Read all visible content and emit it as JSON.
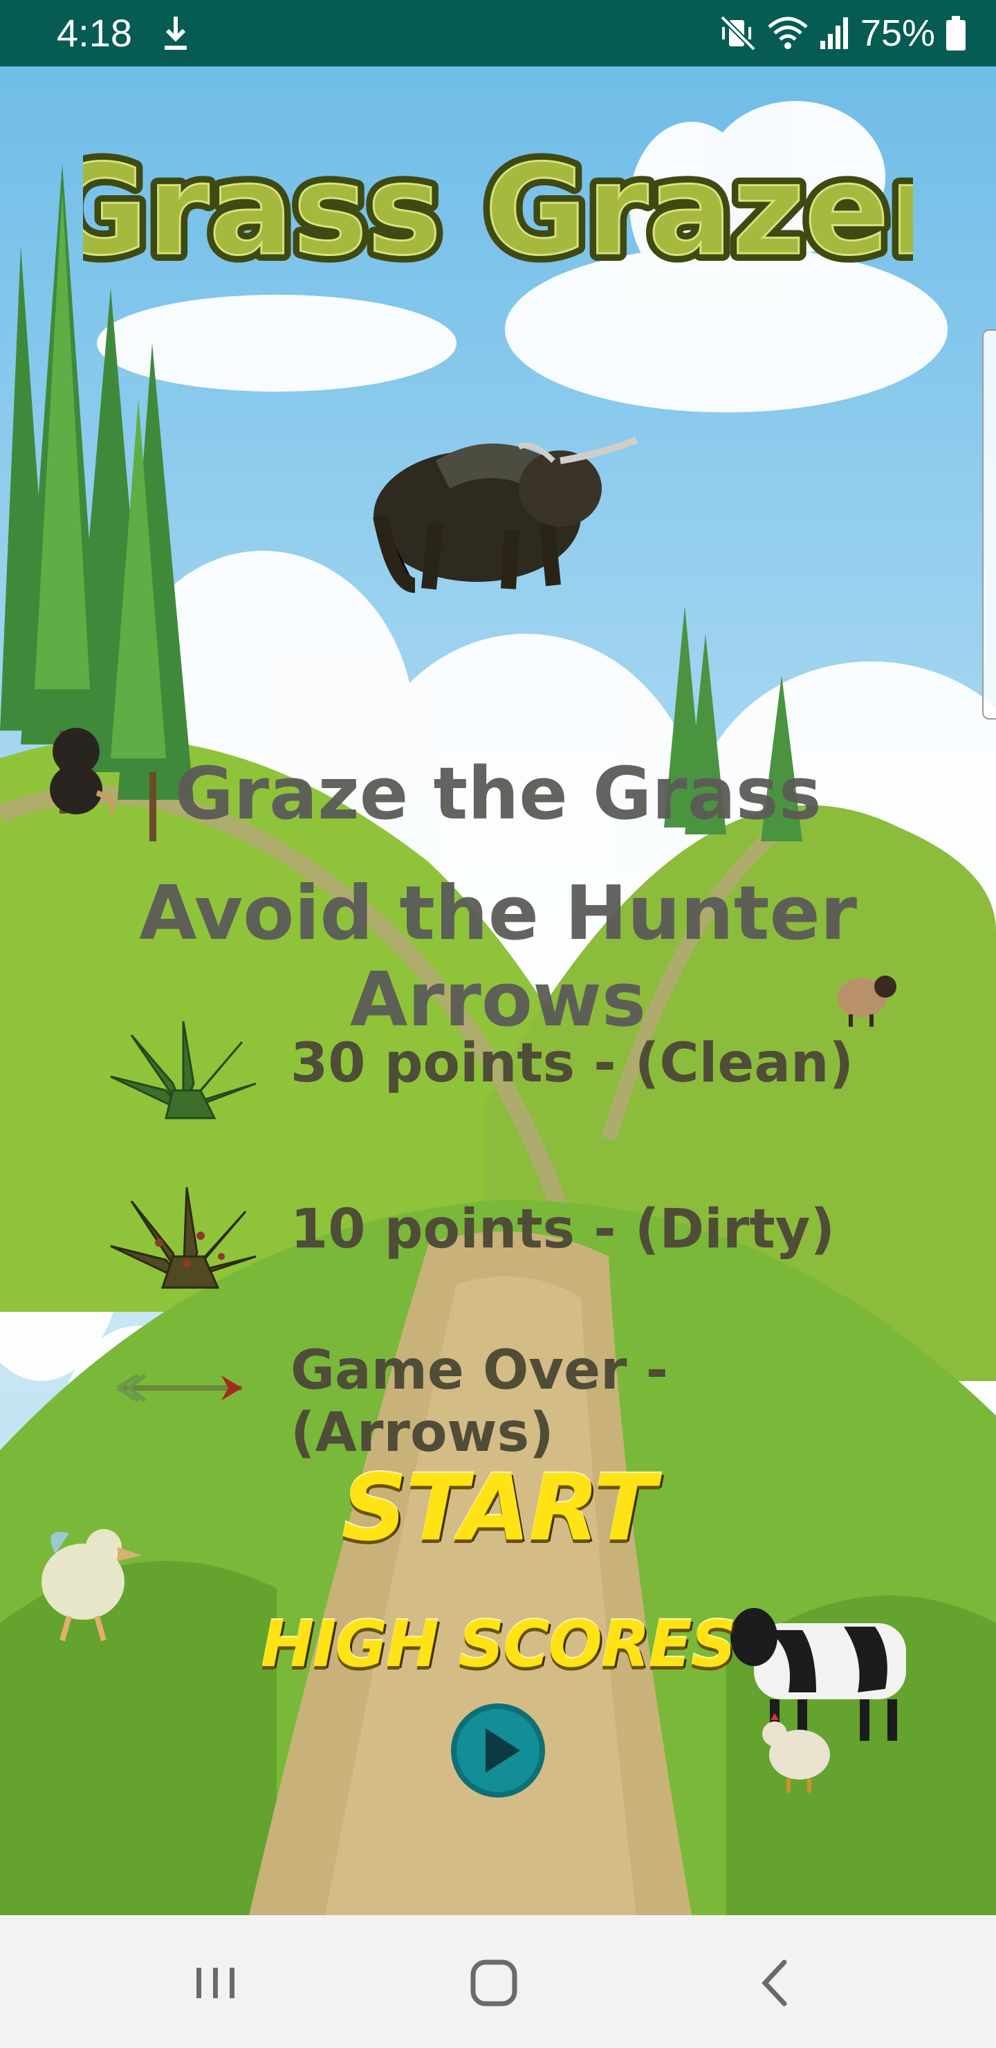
{
  "status_bar": {
    "time": "4:18",
    "battery": "75%",
    "icons": [
      "download-icon",
      "mute-vibrate-icon",
      "wifi-icon",
      "signal-icon",
      "battery-icon"
    ]
  },
  "game": {
    "title": "Grass Grazer",
    "instructions": {
      "line1": "Graze the Grass",
      "line2": "Avoid the Hunter Arrows"
    },
    "legend": [
      {
        "icon": "clean-grass-icon",
        "text": "30 points - (Clean)"
      },
      {
        "icon": "dirty-grass-icon",
        "text": "10 points - (Dirty)"
      },
      {
        "icon": "arrow-icon",
        "text": "Game Over - (Arrows)"
      }
    ],
    "buttons": {
      "start": "START",
      "high_scores": "HIGH SCORES",
      "play": "play-icon"
    },
    "colors": {
      "title_fill": "#a6b83e",
      "title_outline": "#3e4a12",
      "button_text": "#ffe315",
      "play_button": "#138d96",
      "instruction_text": "#5b5b58"
    }
  },
  "nav_bar": {
    "buttons": [
      "recent-apps-icon",
      "home-icon",
      "back-icon"
    ]
  }
}
